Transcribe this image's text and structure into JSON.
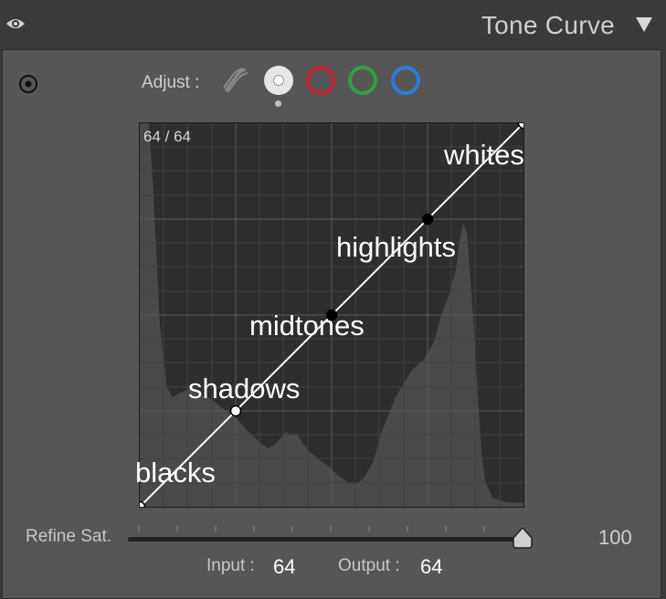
{
  "header": {
    "title": "Tone Curve",
    "visibility_icon": "eye-icon",
    "collapse_icon": "triangle-down-icon"
  },
  "adjust": {
    "label": "Adjust :",
    "channels": [
      {
        "name": "parametric",
        "icon": "parametric-curve-icon"
      },
      {
        "name": "point",
        "icon": "point-curve-icon",
        "selected": true
      },
      {
        "name": "red",
        "icon": "red-channel-icon",
        "color": "#c4262d"
      },
      {
        "name": "green",
        "icon": "green-channel-icon",
        "color": "#2ea043"
      },
      {
        "name": "blue",
        "icon": "blue-channel-icon",
        "color": "#2f7ad8"
      }
    ]
  },
  "graph": {
    "readout": "64 / 64",
    "labels": {
      "whites": "whites",
      "highlights": "highlights",
      "midtones": "midtones",
      "shadows": "shadows",
      "blacks": "blacks"
    },
    "points": [
      {
        "name": "blacks",
        "input": 0,
        "output": 0,
        "style": "open"
      },
      {
        "name": "shadows",
        "input": 0.25,
        "output": 0.25,
        "style": "open"
      },
      {
        "name": "midtones",
        "input": 0.5,
        "output": 0.5,
        "style": "filled"
      },
      {
        "name": "highlights",
        "input": 0.75,
        "output": 0.75,
        "style": "filled"
      },
      {
        "name": "whites",
        "input": 1,
        "output": 1,
        "style": "open"
      }
    ]
  },
  "refine": {
    "label": "Refine Sat.",
    "value": "100",
    "level": 1.0
  },
  "io": {
    "input_label": "Input :",
    "input_value": "64",
    "output_label": "Output :",
    "output_value": "64"
  },
  "colors": {
    "panel": "#565656",
    "graph_bg": "#2e2e2e",
    "histogram": "#4a4a4a"
  }
}
